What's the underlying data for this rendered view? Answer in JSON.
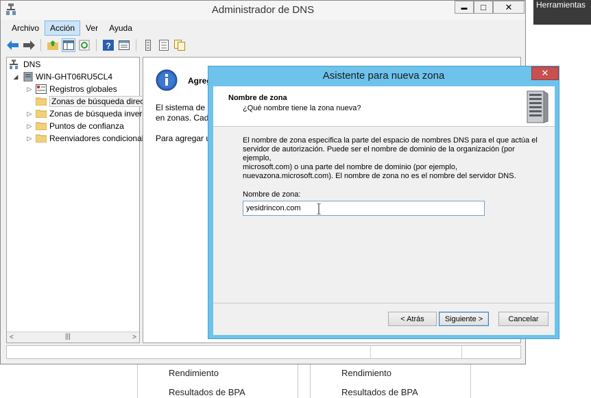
{
  "window": {
    "title": "Administrador de DNS",
    "buttons": {
      "minimize": "▬",
      "maximize": "□",
      "close": "✕"
    }
  },
  "menu": [
    "Archivo",
    "Acción",
    "Ver",
    "Ayuda"
  ],
  "toolbar_icons": [
    "back-icon",
    "forward-icon",
    "up-folder-icon",
    "show-hide-tree-icon",
    "refresh-icon",
    "help-icon",
    "properties-icon",
    "list-icon",
    "detail-icon",
    "copy-icon"
  ],
  "tree": {
    "root": "DNS",
    "server": "WIN-GHT06RU5CL4",
    "items": [
      "Registros globales",
      "Zonas de búsqueda directa",
      "Zonas de búsqueda inversa",
      "Puntos de confianza",
      "Reenviadores condicionales"
    ]
  },
  "content": {
    "heading": "Agregar una nueva zona",
    "text1_line1": "El sistema de nombres de dominio (DNS) permite dividir un espacio de nombres DNS",
    "text1_line2": "en zonas. Cada zona almacena información sobre uno o más dominios DNS contiguos.",
    "text2": "Para agregar una zona nueva, en el menú Acción, haga clic en Zona nueva."
  },
  "dialog": {
    "title": "Asistente para nueva zona",
    "close": "✕",
    "header_title": "Nombre de zona",
    "header_subtitle": "¿Qué nombre tiene la zona  nueva?",
    "description_l1": "El nombre de zona especifica la parte del espacio de nombres DNS para el que actúa el",
    "description_l2": "servidor de autorización. Puede ser el nombre de dominio de la organización (por ejemplo,",
    "description_l3": "microsoft.com) o una parte del nombre de dominio (por ejemplo,",
    "description_l4": "nuevazona.microsoft.com). El nombre de zona no es el nombre del servidor DNS.",
    "zone_label": "Nombre de zona:",
    "zone_value": "yesidrincon.com",
    "back": "< Atrás",
    "next": "Siguiente >",
    "cancel": "Cancelar"
  },
  "background": {
    "tools_label": "Herramientas",
    "col1": [
      "Rendimiento",
      "Resultados de BPA"
    ],
    "col2": [
      "Rendimiento",
      "Resultados de BPA"
    ]
  },
  "colors": {
    "dialog_frame": "#6ec3ec",
    "close_button": "#c75050",
    "menu_highlight": "#cde4f7"
  }
}
